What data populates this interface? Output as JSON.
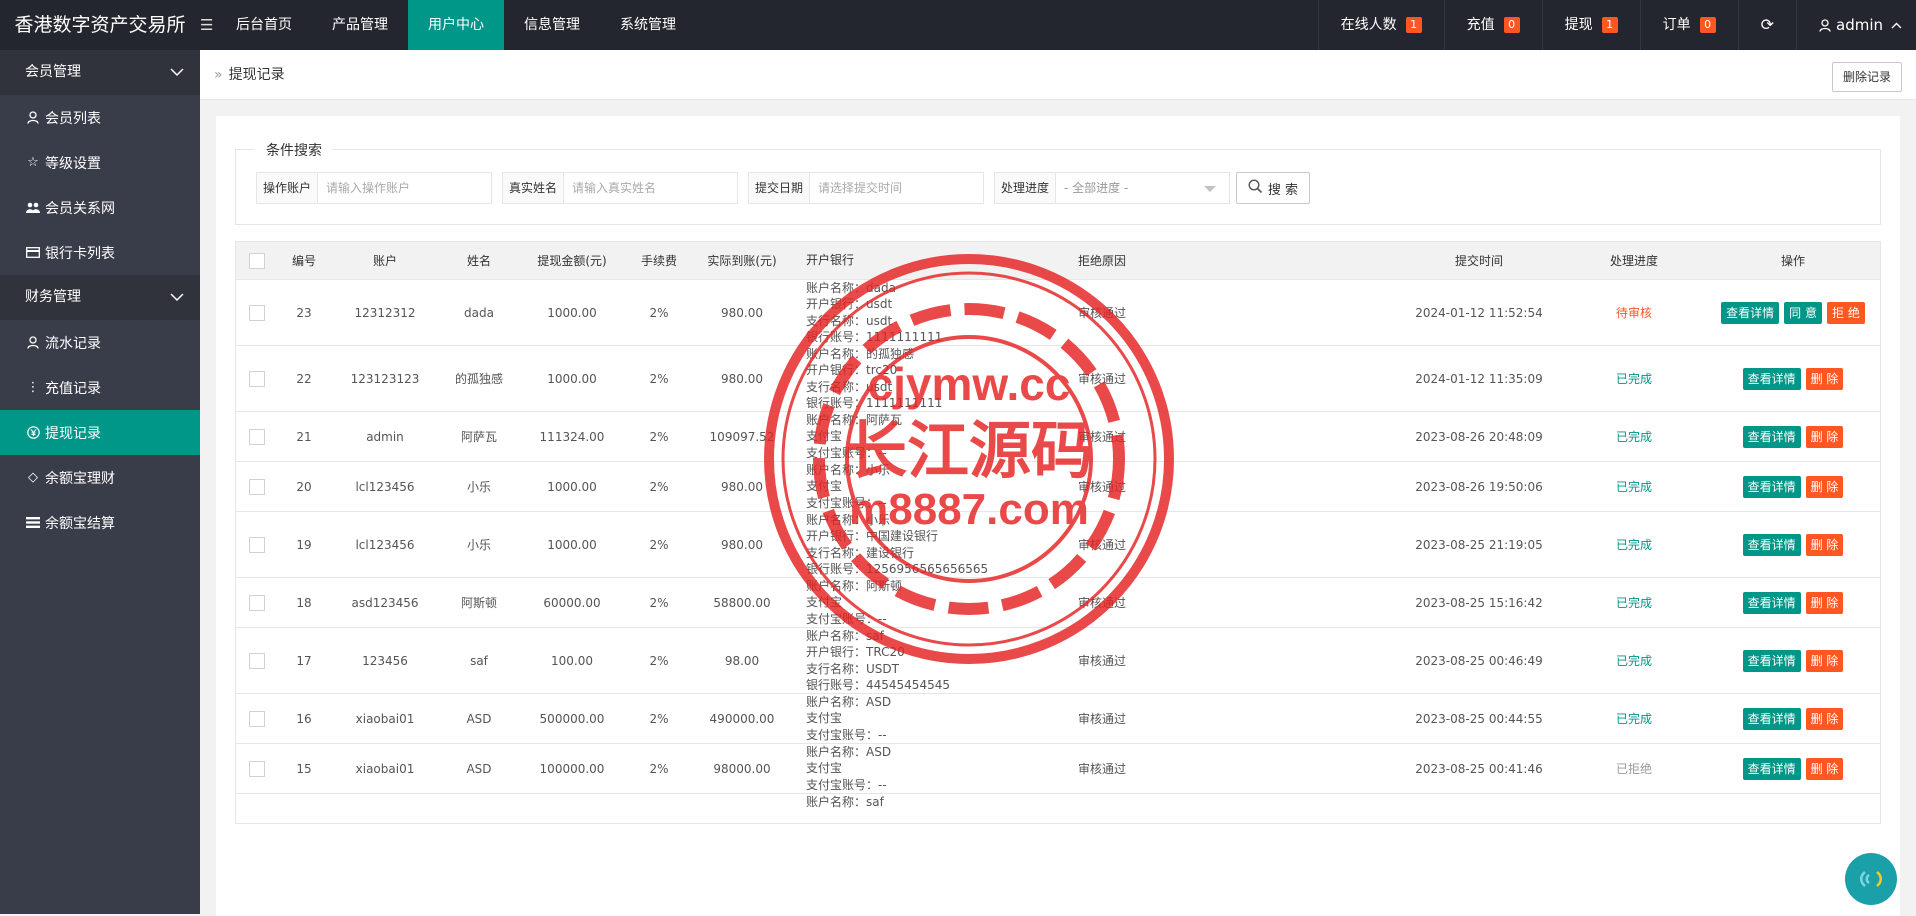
{
  "app": {
    "title": "香港数字资产交易所"
  },
  "topnav": [
    {
      "label": "后台首页"
    },
    {
      "label": "产品管理"
    },
    {
      "label": "用户中心"
    },
    {
      "label": "信息管理"
    },
    {
      "label": "系统管理"
    }
  ],
  "topright": {
    "online": {
      "label": "在线人数",
      "count": "1"
    },
    "recharge": {
      "label": "充值",
      "count": "0"
    },
    "withdraw": {
      "label": "提现",
      "count": "1"
    },
    "orders": {
      "label": "订单",
      "count": "0"
    },
    "user": "admin"
  },
  "sidebar": {
    "group1": "会员管理",
    "group1_items": [
      "会员列表",
      "等级设置",
      "会员关系网",
      "银行卡列表"
    ],
    "group2": "财务管理",
    "group2_items": [
      "流水记录",
      "充值记录",
      "提现记录",
      "余额宝理财",
      "余额宝结算"
    ]
  },
  "breadcrumb": "提现记录",
  "delete_records_label": "删除记录",
  "search": {
    "legend": "条件搜索",
    "account_label": "操作账户",
    "account_placeholder": "请输入操作账户",
    "realname_label": "真实姓名",
    "realname_placeholder": "请输入真实姓名",
    "date_label": "提交日期",
    "date_placeholder": "请选择提交时间",
    "progress_label": "处理进度",
    "progress_value": "- 全部进度 -",
    "button": "搜 索"
  },
  "table": {
    "headers": [
      "编号",
      "账户",
      "姓名",
      "提现金额(元)",
      "手续费",
      "实际到账(元)",
      "开户银行",
      "拒绝原因",
      "提交时间",
      "处理进度",
      "操作"
    ],
    "rows": [
      {
        "id": "23",
        "account": "12312312",
        "name": "dada",
        "amount": "1000.00",
        "fee": "2%",
        "real": "980.00",
        "bank": [
          "账户名称：dada",
          "开户银行：usdt",
          "支行名称：usdt",
          "银行账号：1111111111"
        ],
        "reason": "审核通过",
        "time": "2024-01-12 11:52:54",
        "status": "待审核",
        "status_type": "pending",
        "ops": [
          "查看详情",
          "同 意",
          "拒 绝"
        ]
      },
      {
        "id": "22",
        "account": "123123123",
        "name": "的孤独感",
        "amount": "1000.00",
        "fee": "2%",
        "real": "980.00",
        "bank": [
          "账户名称：的孤独感",
          "开户银行：trc20",
          "支行名称：usdt",
          "银行账号：1111111111"
        ],
        "reason": "审核通过",
        "time": "2024-01-12 11:35:09",
        "status": "已完成",
        "status_type": "done",
        "ops": [
          "查看详情",
          "删 除"
        ]
      },
      {
        "id": "21",
        "account": "admin",
        "name": "阿萨瓦",
        "amount": "111324.00",
        "fee": "2%",
        "real": "109097.52",
        "bank": [
          "账户名称：阿萨瓦",
          "支付宝",
          "支付宝账号：--"
        ],
        "reason": "审核通过",
        "time": "2023-08-26 20:48:09",
        "status": "已完成",
        "status_type": "done",
        "ops": [
          "查看详情",
          "删 除"
        ]
      },
      {
        "id": "20",
        "account": "lcl123456",
        "name": "小乐",
        "amount": "1000.00",
        "fee": "2%",
        "real": "980.00",
        "bank": [
          "账户名称：小乐",
          "支付宝",
          "支付宝账号：--"
        ],
        "reason": "审核通过",
        "time": "2023-08-26 19:50:06",
        "status": "已完成",
        "status_type": "done",
        "ops": [
          "查看详情",
          "删 除"
        ]
      },
      {
        "id": "19",
        "account": "lcl123456",
        "name": "小乐",
        "amount": "1000.00",
        "fee": "2%",
        "real": "980.00",
        "bank": [
          "账户名称：小乐",
          "开户银行：中国建设银行",
          "支行名称：建设银行",
          "银行账号：1256956565656565"
        ],
        "reason": "审核通过",
        "time": "2023-08-25 21:19:05",
        "status": "已完成",
        "status_type": "done",
        "ops": [
          "查看详情",
          "删 除"
        ]
      },
      {
        "id": "18",
        "account": "asd123456",
        "name": "阿斯顿",
        "amount": "60000.00",
        "fee": "2%",
        "real": "58800.00",
        "bank": [
          "账户名称：阿斯顿",
          "支付宝",
          "支付宝账号：--"
        ],
        "reason": "审核通过",
        "time": "2023-08-25 15:16:42",
        "status": "已完成",
        "status_type": "done",
        "ops": [
          "查看详情",
          "删 除"
        ]
      },
      {
        "id": "17",
        "account": "123456",
        "name": "saf",
        "amount": "100.00",
        "fee": "2%",
        "real": "98.00",
        "bank": [
          "账户名称：saf",
          "开户银行：TRC20",
          "支行名称：USDT",
          "银行账号：44545454545"
        ],
        "reason": "审核通过",
        "time": "2023-08-25 00:46:49",
        "status": "已完成",
        "status_type": "done",
        "ops": [
          "查看详情",
          "删 除"
        ]
      },
      {
        "id": "16",
        "account": "xiaobai01",
        "name": "ASD",
        "amount": "500000.00",
        "fee": "2%",
        "real": "490000.00",
        "bank": [
          "账户名称：ASD",
          "支付宝",
          "支付宝账号：--"
        ],
        "reason": "审核通过",
        "time": "2023-08-25 00:44:55",
        "status": "已完成",
        "status_type": "done",
        "ops": [
          "查看详情",
          "删 除"
        ]
      },
      {
        "id": "15",
        "account": "xiaobai01",
        "name": "ASD",
        "amount": "100000.00",
        "fee": "2%",
        "real": "98000.00",
        "bank": [
          "账户名称：ASD",
          "支付宝",
          "支付宝账号：--"
        ],
        "reason": "审核通过",
        "time": "2023-08-25 00:41:46",
        "status": "已拒绝",
        "status_type": "rejected",
        "ops": [
          "查看详情",
          "删 除"
        ]
      },
      {
        "id": "",
        "account": "",
        "name": "",
        "amount": "",
        "fee": "",
        "real": "",
        "bank": [
          "账户名称：saf"
        ],
        "reason": "",
        "time": "",
        "status": "",
        "status_type": "",
        "ops": []
      }
    ]
  },
  "watermark": {
    "line1": "cjymw.cc",
    "line2": "长江源码",
    "line3": "m8887.com"
  },
  "colors": {
    "accent": "#009688",
    "danger": "#ff5722",
    "topbar": "#23262e",
    "sidebar": "#393d49"
  }
}
